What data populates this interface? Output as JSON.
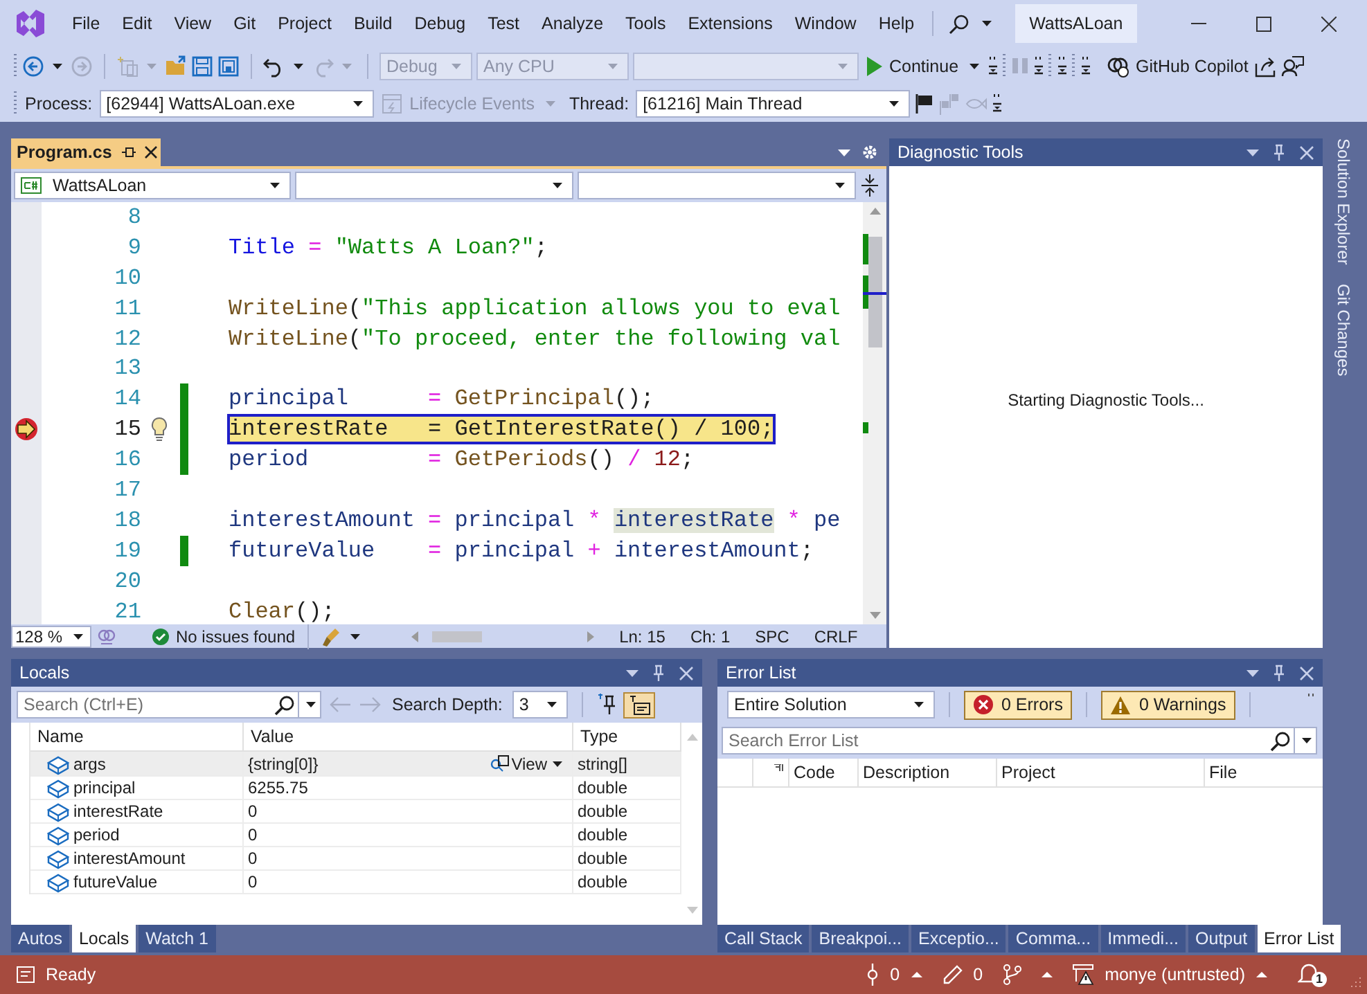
{
  "window": {
    "title": "WattsALoan"
  },
  "menu": [
    "File",
    "Edit",
    "View",
    "Git",
    "Project",
    "Build",
    "Debug",
    "Test",
    "Analyze",
    "Tools",
    "Extensions",
    "Window",
    "Help"
  ],
  "toolbar": {
    "configuration": "Debug",
    "platform": "Any CPU",
    "continue": "Continue",
    "copilot": "GitHub Copilot"
  },
  "debug_bar": {
    "process_label": "Process:",
    "process": "[62944] WattsALoan.exe",
    "lifecycle": "Lifecycle Events",
    "thread_label": "Thread:",
    "thread": "[61216] Main Thread"
  },
  "editor": {
    "tab": "Program.cs",
    "project": "WattsALoan",
    "lines": [
      {
        "number": "8",
        "changed": false,
        "current": false
      },
      {
        "number": "9",
        "changed": false,
        "current": false,
        "tokens": [
          {
            "kind": "property",
            "text": "Title"
          },
          {
            "kind": "operator",
            "text": " = "
          },
          {
            "kind": "string",
            "text": "\"Watts A Loan?\""
          },
          {
            "kind": "plain",
            "text": ";"
          }
        ]
      },
      {
        "number": "10",
        "changed": false,
        "current": false
      },
      {
        "number": "11",
        "changed": false,
        "current": false,
        "tokens": [
          {
            "kind": "method",
            "text": "WriteLine"
          },
          {
            "kind": "plain",
            "text": "("
          },
          {
            "kind": "string",
            "text": "\"This application allows you to eval"
          }
        ]
      },
      {
        "number": "12",
        "changed": false,
        "current": false,
        "tokens": [
          {
            "kind": "method",
            "text": "WriteLine"
          },
          {
            "kind": "plain",
            "text": "("
          },
          {
            "kind": "string",
            "text": "\"To proceed, enter the following val"
          }
        ]
      },
      {
        "number": "13",
        "changed": false,
        "current": false
      },
      {
        "number": "14",
        "changed": true,
        "current": false,
        "tokens": [
          {
            "kind": "variable",
            "text": "principal      "
          },
          {
            "kind": "operator",
            "text": "= "
          },
          {
            "kind": "method",
            "text": "GetPrincipal"
          },
          {
            "kind": "plain",
            "text": "();"
          }
        ]
      },
      {
        "number": "15",
        "changed": true,
        "current": true,
        "tokens": [
          {
            "kind": "variable",
            "text": "interestRate   "
          },
          {
            "kind": "operator",
            "text": "= "
          },
          {
            "kind": "method",
            "text": "GetInterestRate"
          },
          {
            "kind": "plain",
            "text": "() "
          },
          {
            "kind": "operator",
            "text": "/ "
          },
          {
            "kind": "number",
            "text": "100"
          },
          {
            "kind": "plain",
            "text": ";"
          }
        ]
      },
      {
        "number": "16",
        "changed": true,
        "current": false,
        "tokens": [
          {
            "kind": "variable",
            "text": "period         "
          },
          {
            "kind": "operator",
            "text": "= "
          },
          {
            "kind": "method",
            "text": "GetPeriods"
          },
          {
            "kind": "plain",
            "text": "() "
          },
          {
            "kind": "operator",
            "text": "/ "
          },
          {
            "kind": "number",
            "text": "12"
          },
          {
            "kind": "plain",
            "text": ";"
          }
        ]
      },
      {
        "number": "17",
        "changed": false,
        "current": false
      },
      {
        "number": "18",
        "changed": false,
        "current": false,
        "tokens": [
          {
            "kind": "variable",
            "text": "interestAmount "
          },
          {
            "kind": "operator",
            "text": "= "
          },
          {
            "kind": "variable",
            "text": "principal "
          },
          {
            "kind": "operator",
            "text": "* "
          },
          {
            "kind": "reference",
            "text": "interestRate"
          },
          {
            "kind": "operator",
            "text": " * "
          },
          {
            "kind": "variable",
            "text": "pe"
          }
        ]
      },
      {
        "number": "19",
        "changed": true,
        "current": false,
        "tokens": [
          {
            "kind": "variable",
            "text": "futureValue    "
          },
          {
            "kind": "operator",
            "text": "= "
          },
          {
            "kind": "variable",
            "text": "principal "
          },
          {
            "kind": "operator",
            "text": "+ "
          },
          {
            "kind": "variable",
            "text": "interestAmount"
          },
          {
            "kind": "plain",
            "text": ";"
          }
        ]
      },
      {
        "number": "20",
        "changed": false,
        "current": false
      },
      {
        "number": "21",
        "changed": false,
        "current": false,
        "tokens": [
          {
            "kind": "method",
            "text": "Clear"
          },
          {
            "kind": "plain",
            "text": "();"
          }
        ]
      }
    ],
    "zoom": "128 %",
    "issues": "No issues found",
    "ln": "Ln: 15",
    "ch": "Ch: 1",
    "whitespace": "SPC",
    "line_ending": "CRLF"
  },
  "diagnostic_tools": {
    "title": "Diagnostic Tools",
    "message": "Starting Diagnostic Tools..."
  },
  "side_tabs": [
    "Solution Explorer",
    "Git Changes"
  ],
  "locals": {
    "title": "Locals",
    "search": {
      "placeholder": "Search (Ctrl+E)"
    },
    "depth_label": "Search Depth:",
    "depth": "3",
    "columns": [
      "Name",
      "Value",
      "Type"
    ],
    "rows": [
      {
        "name": "args",
        "value": "{string[0]}",
        "visualizer": "View",
        "type": "string[]",
        "selected": true
      },
      {
        "name": "principal",
        "value": "6255.75",
        "type": "double",
        "selected": false
      },
      {
        "name": "interestRate",
        "value": "0",
        "type": "double",
        "selected": false
      },
      {
        "name": "period",
        "value": "0",
        "type": "double",
        "selected": false
      },
      {
        "name": "interestAmount",
        "value": "0",
        "type": "double",
        "selected": false
      },
      {
        "name": "futureValue",
        "value": "0",
        "type": "double",
        "selected": false
      }
    ],
    "tabs": [
      {
        "label": "Autos",
        "selected": false
      },
      {
        "label": "Locals",
        "selected": true
      },
      {
        "label": "Watch 1",
        "selected": false
      }
    ]
  },
  "error_list": {
    "title": "Error List",
    "scope": "Entire Solution",
    "errors": "0 Errors",
    "warnings": "0 Warnings",
    "search": {
      "placeholder": "Search Error List"
    },
    "columns": [
      "Code",
      "Description",
      "Project",
      "File"
    ],
    "tabs": [
      {
        "label": "Call Stack",
        "selected": false
      },
      {
        "label": "Breakpoi...",
        "selected": false
      },
      {
        "label": "Exceptio...",
        "selected": false
      },
      {
        "label": "Comma...",
        "selected": false
      },
      {
        "label": "Immedi...",
        "selected": false
      },
      {
        "label": "Output",
        "selected": false
      },
      {
        "label": "Error List",
        "selected": true
      }
    ]
  },
  "status_bar": {
    "state": "Ready",
    "commits": "0",
    "changes": "0",
    "user": "monye (untrusted)",
    "notifications": "1"
  }
}
